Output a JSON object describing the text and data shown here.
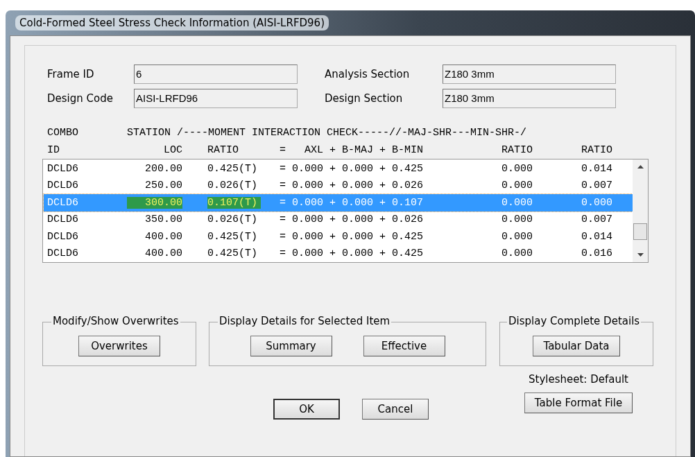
{
  "window": {
    "title": "Cold-Formed Steel Stress Check Information (AISI-LRFD96)"
  },
  "fields": [
    {
      "label": "Frame ID",
      "value": "6"
    },
    {
      "label": "Analysis Section",
      "value": "Z180 3mm"
    },
    {
      "label": "Design Code",
      "value": "AISI-LRFD96"
    },
    {
      "label": "Design Section",
      "value": "Z180 3mm"
    }
  ],
  "table": {
    "header_1": [
      "COMBO",
      "STATION /----MOMENT INTERACTION CHECK-----//-MAJ-SHR---MIN-SHR-/"
    ],
    "columns": [
      "ID",
      "LOC",
      "RATIO",
      "=   AXL + B-MAJ + B-MIN",
      "RATIO",
      "RATIO"
    ],
    "rows": [
      {
        "cells": [
          "DCLD6",
          "200.00",
          "0.425(T)",
          "= 0.000 + 0.000 + 0.425",
          "0.000",
          "0.014"
        ],
        "selected": false
      },
      {
        "cells": [
          "DCLD6",
          "250.00",
          "0.026(T)",
          "= 0.000 + 0.000 + 0.026",
          "0.000",
          "0.007"
        ],
        "selected": false
      },
      {
        "cells": [
          "DCLD6",
          "300.00",
          "0.107(T)",
          "= 0.000 + 0.000 + 0.107",
          "0.000",
          "0.000"
        ],
        "selected": true
      },
      {
        "cells": [
          "DCLD6",
          "350.00",
          "0.026(T)",
          "= 0.000 + 0.000 + 0.026",
          "0.000",
          "0.007"
        ],
        "selected": false
      },
      {
        "cells": [
          "DCLD6",
          "400.00",
          "0.425(T)",
          "= 0.000 + 0.000 + 0.425",
          "0.000",
          "0.014"
        ],
        "selected": false
      },
      {
        "cells": [
          "DCLD6",
          "400.00",
          "0.425(T)",
          "= 0.000 + 0.000 + 0.425",
          "0.000",
          "0.016"
        ],
        "selected": false
      }
    ]
  },
  "groups": [
    {
      "title": "Modify/Show Overwrites",
      "buttons": [
        "Overwrites"
      ]
    },
    {
      "title": "Display Details for Selected Item",
      "buttons": [
        "Summary",
        "Effective"
      ]
    },
    {
      "title": "Display Complete Details",
      "buttons": [
        "Tabular Data"
      ]
    }
  ],
  "stylesheet": "Stylesheet: Default",
  "buttons": [
    {
      "label": "OK",
      "default": true
    },
    {
      "label": "Cancel",
      "default": false
    }
  ],
  "format_button": "Table Format File"
}
